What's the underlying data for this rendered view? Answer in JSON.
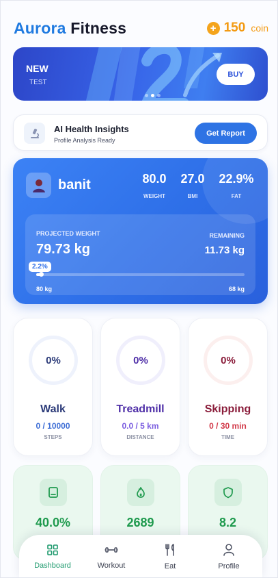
{
  "header": {
    "title_brand": "Aurora",
    "title_rest": "Fitness",
    "coin_symbol": "+",
    "coins": "150",
    "coin_unit": "coin"
  },
  "banner": {
    "badge": "NEW",
    "subtitle": "TEST",
    "button": "BUY",
    "slides": 3,
    "active_slide": 2
  },
  "insights": {
    "title": "AI Health Insights",
    "subtitle": "Profile Analysis Ready",
    "button": "Get Report"
  },
  "profile": {
    "username": "banit",
    "stats": [
      {
        "value": "80.0",
        "label": "WEIGHT"
      },
      {
        "value": "27.0",
        "label": "BMI"
      },
      {
        "value": "22.9%",
        "label": "FAT"
      }
    ],
    "projected_label": "PROJECTED WEIGHT",
    "projected_value": "79.73 kg",
    "remaining_label": "REMAINING",
    "remaining_value": "11.73 kg",
    "progress_badge": "2.2%",
    "progress_fraction": 0.022,
    "range_start": "80 kg",
    "range_end": "68 kg"
  },
  "activities": [
    {
      "percent": "0%",
      "name": "Walk",
      "progress": "0 / 10000",
      "unit": "STEPS"
    },
    {
      "percent": "0%",
      "name": "Treadmill",
      "progress": "0.0 / 5 km",
      "unit": "DISTANCE"
    },
    {
      "percent": "0%",
      "name": "Skipping",
      "progress": "0 / 30 min",
      "unit": "TIME"
    }
  ],
  "metrics": [
    {
      "icon": "scale-icon",
      "value": "40.0%"
    },
    {
      "icon": "flame-icon",
      "value": "2689"
    },
    {
      "icon": "shield-icon",
      "value": "8.2"
    }
  ],
  "nav": {
    "items": [
      {
        "label": "Dashboard",
        "icon": "grid-icon",
        "active": true
      },
      {
        "label": "Workout",
        "icon": "dumbbell-icon",
        "active": false
      },
      {
        "label": "Eat",
        "icon": "fork-knife-icon",
        "active": false
      },
      {
        "label": "Profile",
        "icon": "person-icon",
        "active": false
      }
    ]
  },
  "colors": {
    "brand_blue": "#1f7ae0",
    "coin_orange": "#f39a12",
    "card_blue": "#2e6fe8",
    "metric_green": "#1f9a4e",
    "nav_active": "#1f9a6e"
  }
}
